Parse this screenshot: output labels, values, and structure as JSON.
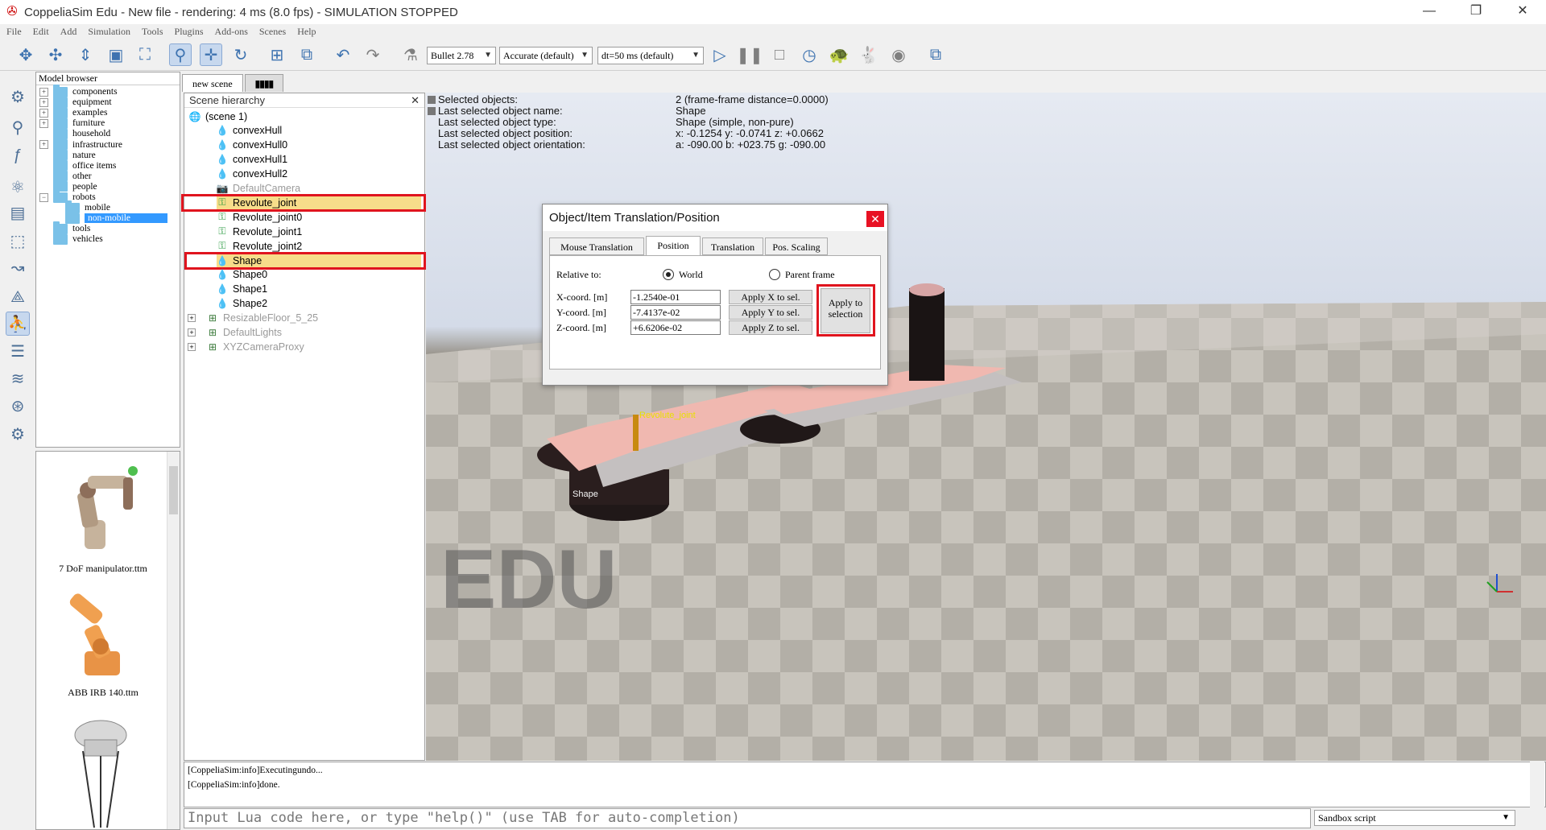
{
  "window": {
    "title": "CoppeliaSim Edu - New file - rendering: 4 ms (8.0 fps) - SIMULATION STOPPED",
    "minimize": "—",
    "restore": "❐",
    "close": "✕"
  },
  "menu": [
    "File",
    "Edit",
    "Add",
    "Simulation",
    "Tools",
    "Plugins",
    "Add-ons",
    "Scenes",
    "Help"
  ],
  "toolbar": {
    "engine": "Bullet 2.78",
    "accuracy": "Accurate (default)",
    "timestep": "dt=50 ms (default)"
  },
  "model_browser": {
    "title": "Model browser",
    "items": [
      {
        "label": "components",
        "expandable": true
      },
      {
        "label": "equipment",
        "expandable": true
      },
      {
        "label": "examples",
        "expandable": true
      },
      {
        "label": "furniture",
        "expandable": true
      },
      {
        "label": "household",
        "expandable": false
      },
      {
        "label": "infrastructure",
        "expandable": true
      },
      {
        "label": "nature",
        "expandable": false
      },
      {
        "label": "office items",
        "expandable": false
      },
      {
        "label": "other",
        "expandable": false
      },
      {
        "label": "people",
        "expandable": false
      },
      {
        "label": "robots",
        "expandable": true,
        "expanded": true
      },
      {
        "label": "mobile",
        "child": true
      },
      {
        "label": "non-mobile",
        "child": true,
        "selected": true
      },
      {
        "label": "tools",
        "expandable": false
      },
      {
        "label": "vehicles",
        "expandable": false
      }
    ],
    "thumbnails": [
      "7 DoF manipulator.ttm",
      "ABB IRB 140.ttm"
    ]
  },
  "scene_tabs": [
    "new scene",
    "▮▮▮▮"
  ],
  "hierarchy": {
    "title": "Scene hierarchy",
    "items": [
      {
        "label": "(scene 1)",
        "icon": "globe-icon"
      },
      {
        "label": "convexHull",
        "icon": "shape-icon"
      },
      {
        "label": "convexHull0",
        "icon": "shape-icon"
      },
      {
        "label": "convexHull1",
        "icon": "shape-icon"
      },
      {
        "label": "convexHull2",
        "icon": "shape-icon"
      },
      {
        "label": "DefaultCamera",
        "icon": "camera-icon",
        "dim": true
      },
      {
        "label": "Revolute_joint",
        "icon": "joint-icon",
        "highlight": true
      },
      {
        "label": "Revolute_joint0",
        "icon": "joint-icon"
      },
      {
        "label": "Revolute_joint1",
        "icon": "joint-icon"
      },
      {
        "label": "Revolute_joint2",
        "icon": "joint-icon"
      },
      {
        "label": "Shape",
        "icon": "shape-icon",
        "highlight": true
      },
      {
        "label": "Shape0",
        "icon": "shape-icon"
      },
      {
        "label": "Shape1",
        "icon": "shape-icon"
      },
      {
        "label": "Shape2",
        "icon": "shape-icon"
      },
      {
        "label": "ResizableFloor_5_25",
        "icon": "model-icon",
        "dim": true
      },
      {
        "label": "DefaultLights",
        "icon": "model-icon",
        "dim": true
      },
      {
        "label": "XYZCameraProxy",
        "icon": "model-icon",
        "dim": true
      }
    ]
  },
  "info": {
    "labels": [
      "Selected objects:",
      "Last selected object name:",
      "Last selected object type:",
      "Last selected object position:",
      "Last selected object orientation:"
    ],
    "values": [
      "2 (frame-frame distance=0.0000)",
      "Shape",
      "Shape (simple, non-pure)",
      "x: -0.1254    y: -0.0741    z: +0.0662",
      "a: -090.00    b: +023.75    g: -090.00"
    ]
  },
  "dialog": {
    "title": "Object/Item Translation/Position",
    "close": "✕",
    "tabs": [
      "Mouse Translation",
      "Position",
      "Translation",
      "Pos. Scaling"
    ],
    "active_tab": "Position",
    "relative_to": "Relative to:",
    "world": "World",
    "parent": "Parent frame",
    "x_label": "X-coord. [m]",
    "y_label": "Y-coord. [m]",
    "z_label": "Z-coord. [m]",
    "x_value": "-1.2540e-01",
    "y_value": "-7.4137e-02",
    "z_value": "+6.6206e-02",
    "apply_x": "Apply X to sel.",
    "apply_y": "Apply Y to sel.",
    "apply_z": "Apply Z to sel.",
    "apply_all_1": "Apply to",
    "apply_all_2": "selection"
  },
  "scene_labels": {
    "joint": "Revolute_joint",
    "shape": "Shape",
    "watermark": "EDU"
  },
  "console": {
    "lines": [
      "[CoppeliaSim:info]Executingundo...",
      "[CoppeliaSim:info]done."
    ],
    "input_placeholder": "Input Lua code here, or type \"help()\" (use TAB for auto-completion)",
    "script_select": "Sandbox script"
  }
}
